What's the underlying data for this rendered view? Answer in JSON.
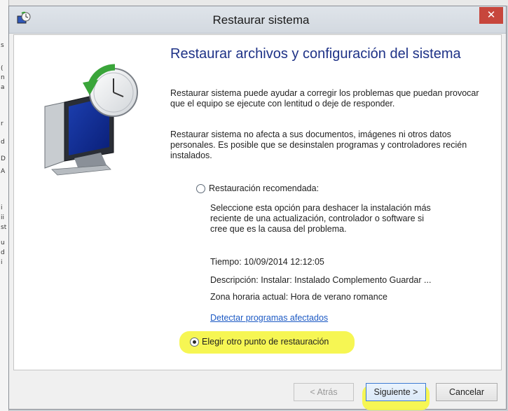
{
  "window": {
    "title": "Restaurar sistema",
    "close_label": "✕"
  },
  "background": {
    "glyphs": [
      "s",
      "(",
      "n",
      "a",
      "r",
      "d",
      "D",
      "A",
      "i",
      "ii",
      "st",
      "u",
      "d",
      "i"
    ]
  },
  "main": {
    "heading": "Restaurar archivos y configuración del sistema",
    "paragraph1": "Restaurar sistema puede ayudar a corregir los problemas que puedan provocar que el equipo se ejecute con lentitud o deje de responder.",
    "paragraph2": "Restaurar sistema no afecta a sus documentos, imágenes ni otros datos personales. Es posible que se desinstalen programas y controladores recién instalados."
  },
  "recommended": {
    "label": "Restauración recomendada:",
    "selected": false,
    "description_lines": [
      "Seleccione esta opción para deshacer la instalación más",
      "reciente de una actualización, controlador o software si",
      "cree que es la causa del problema."
    ],
    "time": "Tiempo: 10/09/2014 12:12:05",
    "description": "Descripción: Instalar: Instalado Complemento Guardar ...",
    "timezone": "Zona horaria actual: Hora de verano romance",
    "link": "Detectar programas afectados"
  },
  "choose_other": {
    "label": "Elegir otro punto de restauración",
    "selected": true
  },
  "buttons": {
    "back": "< Atrás",
    "next": "Siguiente >",
    "cancel": "Cancelar"
  },
  "colors": {
    "heading": "#1e3287",
    "link": "#1d5ac4",
    "highlight": "#f6f54a",
    "close": "#c7463c"
  }
}
